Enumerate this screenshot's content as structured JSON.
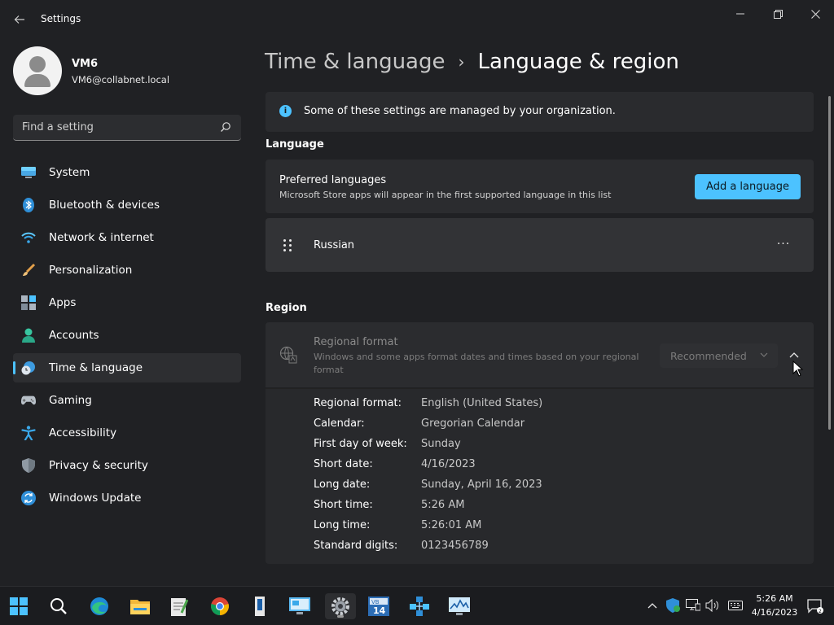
{
  "window": {
    "app_title": "Settings"
  },
  "profile": {
    "name": "VM6",
    "email": "VM6@collabnet.local"
  },
  "search": {
    "placeholder": "Find a setting"
  },
  "sidebar": {
    "items": [
      {
        "label": "System",
        "icon": "system-icon",
        "active": false
      },
      {
        "label": "Bluetooth & devices",
        "icon": "bluetooth-icon",
        "active": false
      },
      {
        "label": "Network & internet",
        "icon": "wifi-icon",
        "active": false
      },
      {
        "label": "Personalization",
        "icon": "brush-icon",
        "active": false
      },
      {
        "label": "Apps",
        "icon": "apps-icon",
        "active": false
      },
      {
        "label": "Accounts",
        "icon": "accounts-icon",
        "active": false
      },
      {
        "label": "Time & language",
        "icon": "time-language-icon",
        "active": true
      },
      {
        "label": "Gaming",
        "icon": "gaming-icon",
        "active": false
      },
      {
        "label": "Accessibility",
        "icon": "accessibility-icon",
        "active": false
      },
      {
        "label": "Privacy & security",
        "icon": "shield-icon",
        "active": false
      },
      {
        "label": "Windows Update",
        "icon": "update-icon",
        "active": false
      }
    ]
  },
  "breadcrumb": {
    "parent": "Time & language",
    "separator": "›",
    "current": "Language & region"
  },
  "banner": {
    "text": "Some of these settings are managed by your organization."
  },
  "language": {
    "section_title": "Language",
    "preferred_title": "Preferred languages",
    "preferred_subtitle": "Microsoft Store apps will appear in the first supported language in this list",
    "add_button": "Add a language",
    "languages": [
      "Russian"
    ],
    "more_label": "···"
  },
  "region": {
    "section_title": "Region",
    "format_title": "Regional format",
    "format_desc": "Windows and some apps format dates and times based on your regional format",
    "format_select": "Recommended",
    "details": [
      {
        "key": "Regional format:",
        "value": "English (United States)"
      },
      {
        "key": "Calendar:",
        "value": "Gregorian Calendar"
      },
      {
        "key": "First day of week:",
        "value": "Sunday"
      },
      {
        "key": "Short date:",
        "value": "4/16/2023"
      },
      {
        "key": "Long date:",
        "value": "Sunday, April 16, 2023"
      },
      {
        "key": "Short time:",
        "value": "5:26 AM"
      },
      {
        "key": "Long time:",
        "value": "5:26:01 AM"
      },
      {
        "key": "Standard digits:",
        "value": "0123456789"
      }
    ]
  },
  "taskbar": {
    "apps": [
      "start-icon",
      "search-icon",
      "edge-icon",
      "file-explorer-icon",
      "notepad-icon",
      "chrome-icon",
      "server-manager-icon",
      "computer-management-icon",
      "settings-icon",
      "vm14-icon",
      "network-icon",
      "performance-icon"
    ],
    "clock_time": "5:26 AM",
    "clock_date": "4/16/2023"
  },
  "colors": {
    "accent": "#4cc2ff",
    "background": "#202124",
    "card": "#2b2c2f"
  }
}
